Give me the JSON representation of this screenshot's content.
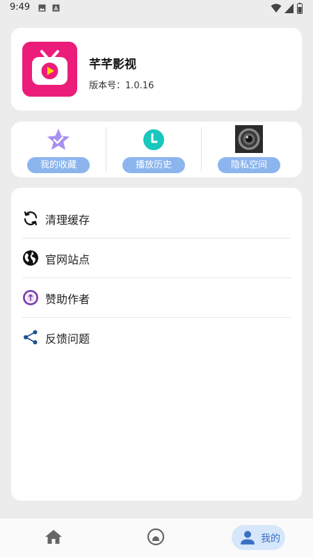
{
  "status_bar": {
    "time": "9:49"
  },
  "app": {
    "name": "芊芊影视",
    "version_text": "版本号：1.0.16"
  },
  "quick_actions": [
    {
      "label": "我的收藏",
      "icon": "star-check-icon"
    },
    {
      "label": "播放历史",
      "icon": "clock-icon"
    },
    {
      "label": "隐私空间",
      "icon": "camera-lens-icon"
    }
  ],
  "menu": [
    {
      "label": "清理缓存",
      "icon": "refresh-icon"
    },
    {
      "label": "官网站点",
      "icon": "globe-icon"
    },
    {
      "label": "赞助作者",
      "icon": "donate-icon"
    },
    {
      "label": "反馈问题",
      "icon": "share-icon"
    }
  ],
  "bottom_nav": {
    "items": [
      {
        "name": "home",
        "icon": "home-icon"
      },
      {
        "name": "discover",
        "icon": "discover-icon"
      },
      {
        "name": "mine",
        "label": "我的",
        "icon": "person-icon",
        "active": true
      }
    ]
  },
  "colors": {
    "brand": "#ec1d7a",
    "chip": "#8cb5ee",
    "nav_active_bg": "#d6e6fb",
    "nav_active_text": "#3c6fc3"
  }
}
